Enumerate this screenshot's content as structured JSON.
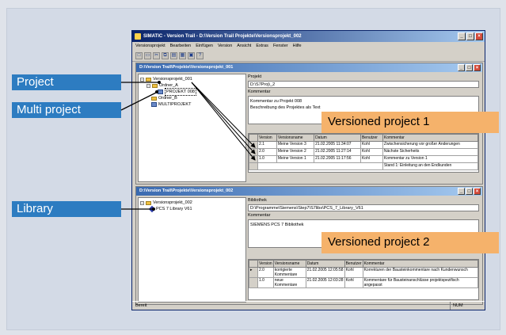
{
  "window": {
    "title": "SIMATIC - Version Trail - D:\\Version Trail Projekte\\Versionsprojekt_002",
    "buttons": [
      "_",
      "□",
      "×"
    ]
  },
  "menu": [
    "Versionsprojekt",
    "Bearbeiten",
    "Einfügen",
    "Version",
    "Ansicht",
    "Extras",
    "Fenster",
    "Hilfe"
  ],
  "toolbar_icons": [
    "new-icon",
    "open-icon",
    "cut-icon",
    "copy-icon",
    "print-icon",
    "archive-icon",
    "view-icon",
    "help-icon"
  ],
  "window1": {
    "title": "D:\\Version Trail\\Projekte\\Versionsprojekt_001",
    "tree": [
      "Versionsprojekt_001",
      "Ordner_A",
      "PROJEKT 008",
      "Ordner_B",
      "MULTIPROJEKT"
    ],
    "project_label": "Projekt",
    "project_value": "D:\\S7Proj\\_2",
    "comment_label": "Kommentar",
    "comment_lines": [
      "Kommentar zu Projekt 008",
      "",
      "Beschreibung des Projektes als Text"
    ],
    "table": {
      "headers": [
        "Version",
        "Versionsname",
        "Datum",
        "Benutzer",
        "Kommentar"
      ],
      "rows": [
        [
          "2.1",
          "Meine Version 3",
          "21.02.2005 11:34:07",
          "Kohl",
          "Zwischensicherung vor großer Änderungen"
        ],
        [
          "2.0",
          "Meine Version 2",
          "21.02.2005 11:27:14",
          "Kohl",
          "Nächste Sicherheits"
        ],
        [
          "1.0",
          "Meine Version 1",
          "21.02.2005 11:17:56",
          "Kohl",
          "Kommentar zu Version 1"
        ]
      ],
      "note": "Stand 1: Einleitung an den Endkunden"
    }
  },
  "window2": {
    "title": "D:\\Version Trail\\Projekte\\Versionsprojekt_002",
    "tree": [
      "Versionsprojekt_002",
      "PCS 7 Library V61"
    ],
    "library_label": "Bibliothek",
    "library_value": "D:\\Programme\\Siemens\\Step7\\S7libs\\PCS_7_Library_V61",
    "comment_label": "Kommentar",
    "comment_value": "SIEMENS PCS 7 Bibliothek",
    "table": {
      "headers": [
        "Version",
        "Versionsname",
        "Datum",
        "Benutzer",
        "Kommentar"
      ],
      "rows": [
        [
          "2.0",
          "korrigierte Kommentare",
          "21.02.2005 12:05:58",
          "Kohl",
          "Korrekturen der Bausteinkommentare nach Kundenwunsch"
        ],
        [
          "1.0",
          "neue Kommentare",
          "21.02.2005 12:03:28",
          "Kohl",
          "Kommentare für Bausteinanschlüsse projektspezifisch angepasst"
        ]
      ]
    }
  },
  "statusbar": {
    "left": "Bereit",
    "right": "NUM"
  },
  "callouts": {
    "project": "Project",
    "multi_project": "Multi project",
    "library": "Library",
    "versioned1": "Versioned project 1",
    "versioned2": "Versioned project 2"
  },
  "colors": {
    "callout_blue": "#2d7cc1",
    "callout_orange": "#f5b26b",
    "title_blue": "#0a246a"
  }
}
